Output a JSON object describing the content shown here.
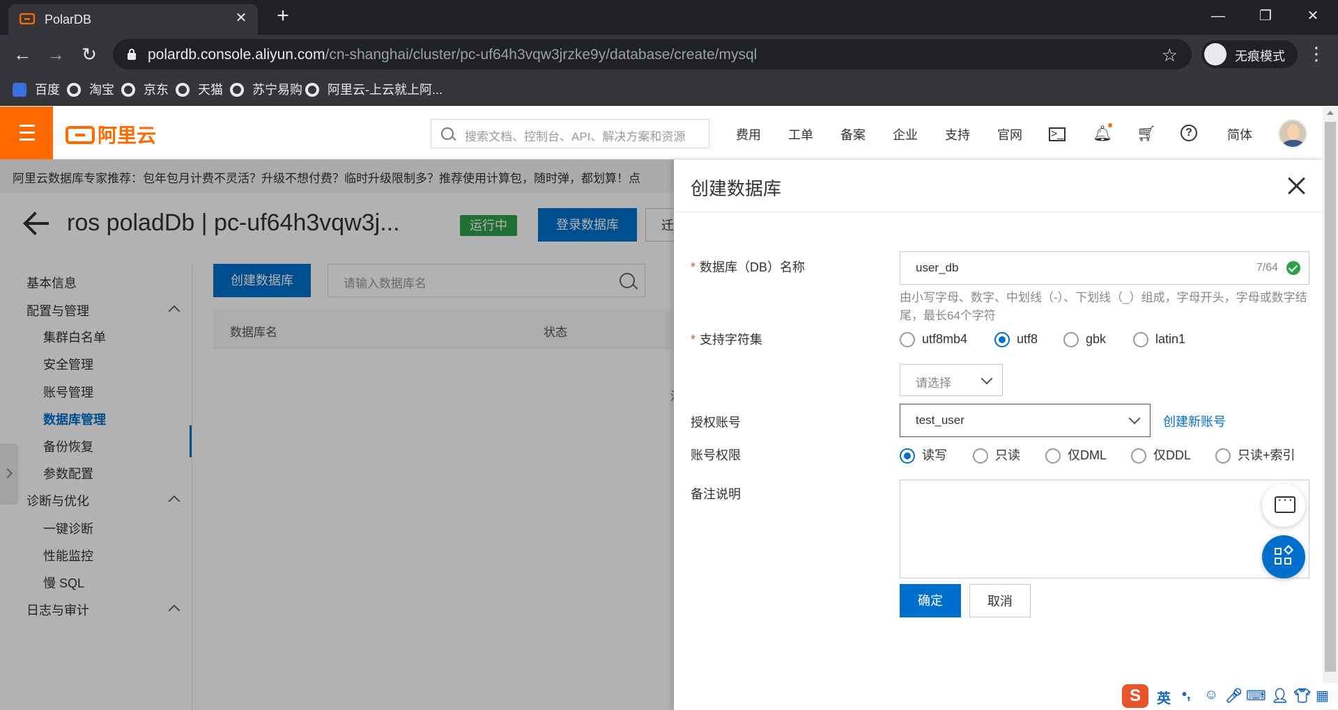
{
  "browser": {
    "tab_title": "PolarDB",
    "url_host": "polardb.console.aliyun.com",
    "url_path": "/cn-shanghai/cluster/pc-uf64h3vqw3jrzke9y/database/create/mysql",
    "incognito_label": "无痕模式",
    "bookmarks": [
      "百度",
      "淘宝",
      "京东",
      "天猫",
      "苏宁易购",
      "阿里云-上云就上阿..."
    ]
  },
  "topnav": {
    "logo_text": "阿里云",
    "search_placeholder": "搜索文档、控制台、API、解决方案和资源",
    "items": [
      "费用",
      "工单",
      "备案",
      "企业",
      "支持",
      "官网"
    ],
    "lang": "简体"
  },
  "promo": {
    "text": "阿里云数据库专家推荐：包年包月计费不灵活？升级不想付费？临时升级限制多？推荐使用计算包，随时弹，都划算！点"
  },
  "header": {
    "title": "ros poladDb | pc-uf64h3vqw3j...",
    "status": "运行中",
    "login_button": "登录数据库",
    "migrate_button": "迁"
  },
  "sidebar": {
    "items": [
      {
        "label": "基本信息"
      },
      {
        "label": "配置与管理"
      },
      {
        "label": "集群白名单"
      },
      {
        "label": "安全管理"
      },
      {
        "label": "账号管理"
      },
      {
        "label": "数据库管理"
      },
      {
        "label": "备份恢复"
      },
      {
        "label": "参数配置"
      },
      {
        "label": "诊断与优化"
      },
      {
        "label": "一键诊断"
      },
      {
        "label": "性能监控"
      },
      {
        "label": "慢 SQL"
      },
      {
        "label": "日志与审计"
      }
    ]
  },
  "main": {
    "create_button": "创建数据库",
    "search_placeholder": "请输入数据库名",
    "columns": [
      "数据库名",
      "状态"
    ],
    "empty_partial": "没"
  },
  "drawer": {
    "title": "创建数据库",
    "db_name_label": "数据库（DB）名称",
    "db_name_value": "user_db",
    "db_name_counter": "7/64",
    "db_name_help": "由小写字母、数字、中划线（-）、下划线（_）组成，字母开头，字母或数字结尾，最长64个字符",
    "charset_label": "支持字符集",
    "charsets": [
      "utf8mb4",
      "utf8",
      "gbk",
      "latin1"
    ],
    "charset_selected": "utf8",
    "collation_placeholder": "请选择",
    "account_label": "授权账号",
    "account_value": "test_user",
    "create_account_link": "创建新账号",
    "privilege_label": "账号权限",
    "privileges": [
      "读写",
      "只读",
      "仅DML",
      "仅DDL",
      "只读+索引"
    ],
    "privilege_selected": "读写",
    "remark_label": "备注说明",
    "confirm_button": "确定",
    "cancel_button": "取消"
  },
  "ime": {
    "logo": "S",
    "mode": "英"
  },
  "colors": {
    "brand_orange": "#ff6a00",
    "primary_blue": "#0070cc",
    "status_green": "#2ea04a"
  }
}
